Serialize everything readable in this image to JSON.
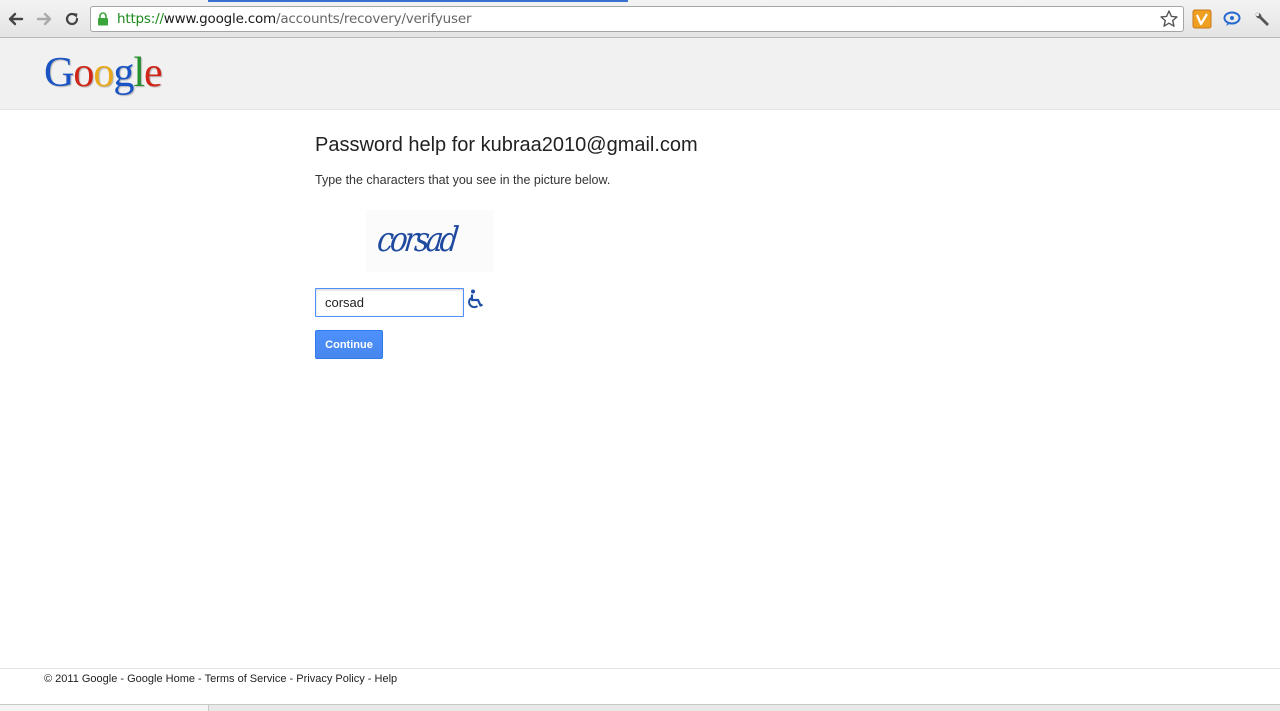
{
  "browser": {
    "url_scheme": "https://",
    "url_host": "www.google.com",
    "url_path": "/accounts/recovery/verifyuser",
    "icons": {
      "back": "back-arrow-icon",
      "forward": "forward-arrow-icon",
      "reload": "reload-icon",
      "lock": "lock-icon",
      "bookmark": "star-icon",
      "ext1": "vimeo-extension-icon",
      "ext2": "chat-extension-icon",
      "settings": "wrench-icon"
    }
  },
  "header": {
    "logo_letters": [
      "G",
      "o",
      "o",
      "g",
      "l",
      "e"
    ],
    "logo_colors": [
      "#1a53c4",
      "#d0261a",
      "#e8a91c",
      "#1a53c4",
      "#27912f",
      "#d0261a"
    ]
  },
  "main": {
    "title": "Password help for kubraa2010@gmail.com",
    "instructions": "Type the characters that you see in the picture below.",
    "captcha_text": "corsad",
    "answer_value": "corsad",
    "continue_label": "Continue"
  },
  "footer": {
    "copyright": "© 2011 Google",
    "links": [
      "Google Home",
      "Terms of Service",
      "Privacy Policy",
      "Help"
    ],
    "separator": " - "
  },
  "colors": {
    "accent": "#4d90fe",
    "header_bg": "#f1f1f1"
  }
}
